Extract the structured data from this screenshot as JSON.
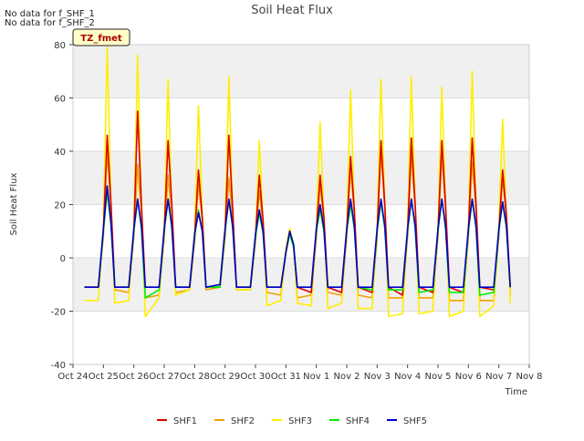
{
  "notes": [
    "No data for f_SHF_1",
    "No data for f_SHF_2"
  ],
  "site_badge": "TZ_fmet",
  "chart_data": {
    "type": "line",
    "title": "Soil Heat Flux",
    "xlabel": "Time",
    "ylabel": "Soil Heat Flux",
    "ylim": [
      -40,
      80
    ],
    "yticks": [
      -40,
      -20,
      0,
      20,
      40,
      60,
      80
    ],
    "xlim": [
      "2023-10-24",
      "2023-11-08"
    ],
    "xtick_labels": [
      "Oct 24",
      "Oct 25",
      "Oct 26",
      "Oct 27",
      "Oct 28",
      "Oct 29",
      "Oct 30",
      "Oct 31",
      "Nov 1",
      "Nov 2",
      "Nov 3",
      "Nov 4",
      "Nov 5",
      "Nov 6",
      "Nov 7",
      "Nov 8"
    ],
    "x": [
      "2023-10-24 09:00",
      "2023-10-24 20:00",
      "2023-10-25 00:00",
      "2023-10-25 03:00",
      "2023-10-25 06:00",
      "2023-10-25 09:00",
      "2023-10-25 20:00",
      "2023-10-26 00:00",
      "2023-10-26 03:00",
      "2023-10-26 06:00",
      "2023-10-26 09:00",
      "2023-10-26 20:00",
      "2023-10-27 00:00",
      "2023-10-27 03:00",
      "2023-10-27 06:00",
      "2023-10-27 09:00",
      "2023-10-27 20:00",
      "2023-10-28 00:00",
      "2023-10-28 03:00",
      "2023-10-28 06:00",
      "2023-10-28 09:00",
      "2023-10-28 20:00",
      "2023-10-29 00:00",
      "2023-10-29 03:00",
      "2023-10-29 06:00",
      "2023-10-29 09:00",
      "2023-10-29 20:00",
      "2023-10-30 00:00",
      "2023-10-30 03:00",
      "2023-10-30 06:00",
      "2023-10-30 09:00",
      "2023-10-30 20:00",
      "2023-10-31 00:00",
      "2023-10-31 03:00",
      "2023-10-31 06:00",
      "2023-10-31 09:00",
      "2023-10-31 20:00",
      "2023-11-01 00:00",
      "2023-11-01 03:00",
      "2023-11-01 06:00",
      "2023-11-01 09:00",
      "2023-11-01 20:00",
      "2023-11-02 00:00",
      "2023-11-02 03:00",
      "2023-11-02 06:00",
      "2023-11-02 09:00",
      "2023-11-02 20:00",
      "2023-11-03 00:00",
      "2023-11-03 03:00",
      "2023-11-03 06:00",
      "2023-11-03 09:00",
      "2023-11-03 20:00",
      "2023-11-04 00:00",
      "2023-11-04 03:00",
      "2023-11-04 06:00",
      "2023-11-04 09:00",
      "2023-11-04 20:00",
      "2023-11-05 00:00",
      "2023-11-05 03:00",
      "2023-11-05 06:00",
      "2023-11-05 09:00",
      "2023-11-05 20:00",
      "2023-11-06 00:00",
      "2023-11-06 03:00",
      "2023-11-06 06:00",
      "2023-11-06 09:00",
      "2023-11-06 20:00",
      "2023-11-07 00:00",
      "2023-11-07 03:00",
      "2023-11-07 06:00",
      "2023-11-07 09:00"
    ],
    "series": [
      {
        "name": "SHF1",
        "color": "#dd0000",
        "values": [
          -11,
          -11,
          10,
          46,
          20,
          -11,
          -11,
          10,
          55,
          20,
          -11,
          -11,
          10,
          44,
          20,
          -11,
          -11,
          8,
          33,
          15,
          -11,
          -11,
          10,
          46,
          18,
          -11,
          -11,
          8,
          31,
          14,
          -11,
          -11,
          2,
          10,
          5,
          -11,
          -13,
          10,
          31,
          15,
          -11,
          -13,
          10,
          38,
          18,
          -11,
          -13,
          10,
          44,
          20,
          -11,
          -14,
          10,
          45,
          20,
          -11,
          -13,
          10,
          44,
          20,
          -11,
          -13,
          10,
          45,
          20,
          -11,
          -12,
          10,
          33,
          16,
          -11
        ]
      },
      {
        "name": "SHF2",
        "color": "#f0a000",
        "values": [
          -11,
          -11,
          8,
          40,
          18,
          -12,
          -13,
          8,
          35,
          16,
          -15,
          -14,
          8,
          31,
          15,
          -13,
          -12,
          6,
          28,
          14,
          -12,
          -11,
          8,
          30,
          15,
          -12,
          -12,
          6,
          25,
          12,
          -13,
          -14,
          2,
          9,
          4,
          -15,
          -14,
          8,
          28,
          13,
          -13,
          -14,
          8,
          34,
          16,
          -14,
          -15,
          8,
          40,
          18,
          -15,
          -15,
          8,
          38,
          18,
          -15,
          -15,
          8,
          39,
          18,
          -16,
          -16,
          8,
          36,
          17,
          -16,
          -16,
          8,
          30,
          15,
          -14
        ]
      },
      {
        "name": "SHF3",
        "color": "#ffee00",
        "values": [
          -16,
          -16,
          12,
          79,
          20,
          -17,
          -16,
          12,
          76,
          20,
          -22,
          -15,
          12,
          67,
          18,
          -14,
          -12,
          10,
          57,
          16,
          -11,
          -10,
          12,
          68,
          18,
          -12,
          -12,
          8,
          44,
          14,
          -18,
          -16,
          4,
          11,
          5,
          -17,
          -18,
          12,
          51,
          16,
          -19,
          -17,
          12,
          63,
          18,
          -19,
          -19,
          12,
          67,
          20,
          -22,
          -21,
          12,
          68,
          20,
          -21,
          -20,
          12,
          64,
          20,
          -22,
          -20,
          12,
          70,
          20,
          -22,
          -18,
          12,
          52,
          16,
          -17
        ]
      },
      {
        "name": "SHF4",
        "color": "#00ee00",
        "values": [
          -11,
          -11,
          10,
          25,
          12,
          -11,
          -11,
          10,
          22,
          11,
          -15,
          -12,
          10,
          22,
          11,
          -11,
          -11,
          8,
          18,
          10,
          -11,
          -11,
          10,
          22,
          11,
          -11,
          -11,
          8,
          17,
          9,
          -11,
          -11,
          2,
          9,
          4,
          -11,
          -11,
          10,
          18,
          10,
          -11,
          -11,
          10,
          20,
          11,
          -11,
          -12,
          10,
          21,
          11,
          -12,
          -12,
          10,
          22,
          11,
          -13,
          -12,
          10,
          22,
          11,
          -13,
          -13,
          10,
          22,
          11,
          -14,
          -13,
          10,
          21,
          11,
          -11
        ]
      },
      {
        "name": "SHF5",
        "color": "#0000cc",
        "values": [
          -11,
          -11,
          11,
          27,
          13,
          -11,
          -11,
          11,
          22,
          12,
          -11,
          -11,
          11,
          22,
          12,
          -11,
          -11,
          9,
          17,
          10,
          -11,
          -10,
          11,
          22,
          12,
          -11,
          -11,
          9,
          18,
          10,
          -11,
          -11,
          2,
          10,
          5,
          -11,
          -11,
          11,
          20,
          11,
          -11,
          -11,
          11,
          22,
          12,
          -11,
          -11,
          11,
          22,
          12,
          -11,
          -11,
          11,
          22,
          12,
          -11,
          -11,
          11,
          22,
          12,
          -11,
          -11,
          11,
          22,
          12,
          -11,
          -11,
          11,
          21,
          12,
          -11
        ]
      }
    ],
    "legend_position": "bottom-center",
    "background_bands": true,
    "grid": true
  }
}
